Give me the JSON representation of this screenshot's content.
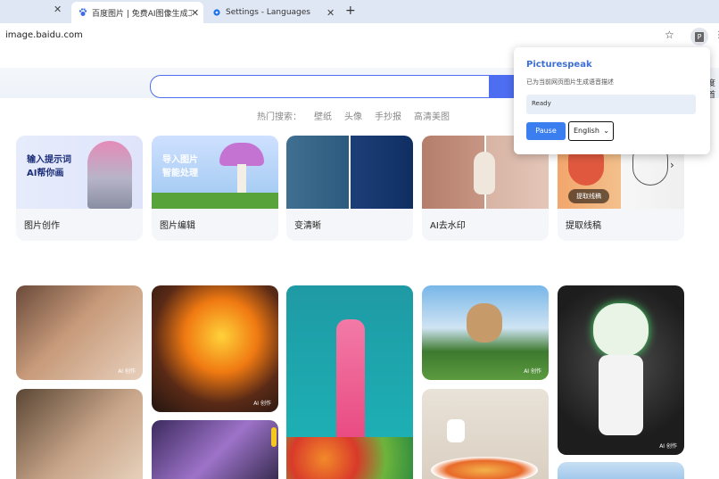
{
  "browser": {
    "tabs": [
      {
        "label": "百度图片 | 免费AI图像生成工具"
      },
      {
        "label": "Settings - Languages"
      }
    ],
    "new_tab": "+",
    "close": "✕",
    "url": "image.baidu.com"
  },
  "page": {
    "hot_search_label": "热门搜索：",
    "hot_tags": [
      "壁纸",
      "头像",
      "手抄报",
      "高清美图"
    ],
    "right_cut_text": "度首",
    "categories": [
      {
        "label": "图片创作",
        "art_text": "输入提示词\nAI帮你画"
      },
      {
        "label": "图片编辑",
        "art_text": "导入图片\n智能处理"
      },
      {
        "label": "变清晰"
      },
      {
        "label": "AI去水印"
      },
      {
        "label": "提取线稿",
        "art_badge": "提取线稿"
      }
    ],
    "ai_tag": "AI 创作"
  },
  "popup": {
    "title": "Picturespeak",
    "description": "已为当前网页图片生成语音描述",
    "status": "Ready",
    "pause_label": "Pause",
    "language": "English"
  },
  "colors": {
    "accent": "#4e6ef2",
    "popup_accent": "#3b7ef0",
    "tabbar": "#dfe7f4"
  }
}
